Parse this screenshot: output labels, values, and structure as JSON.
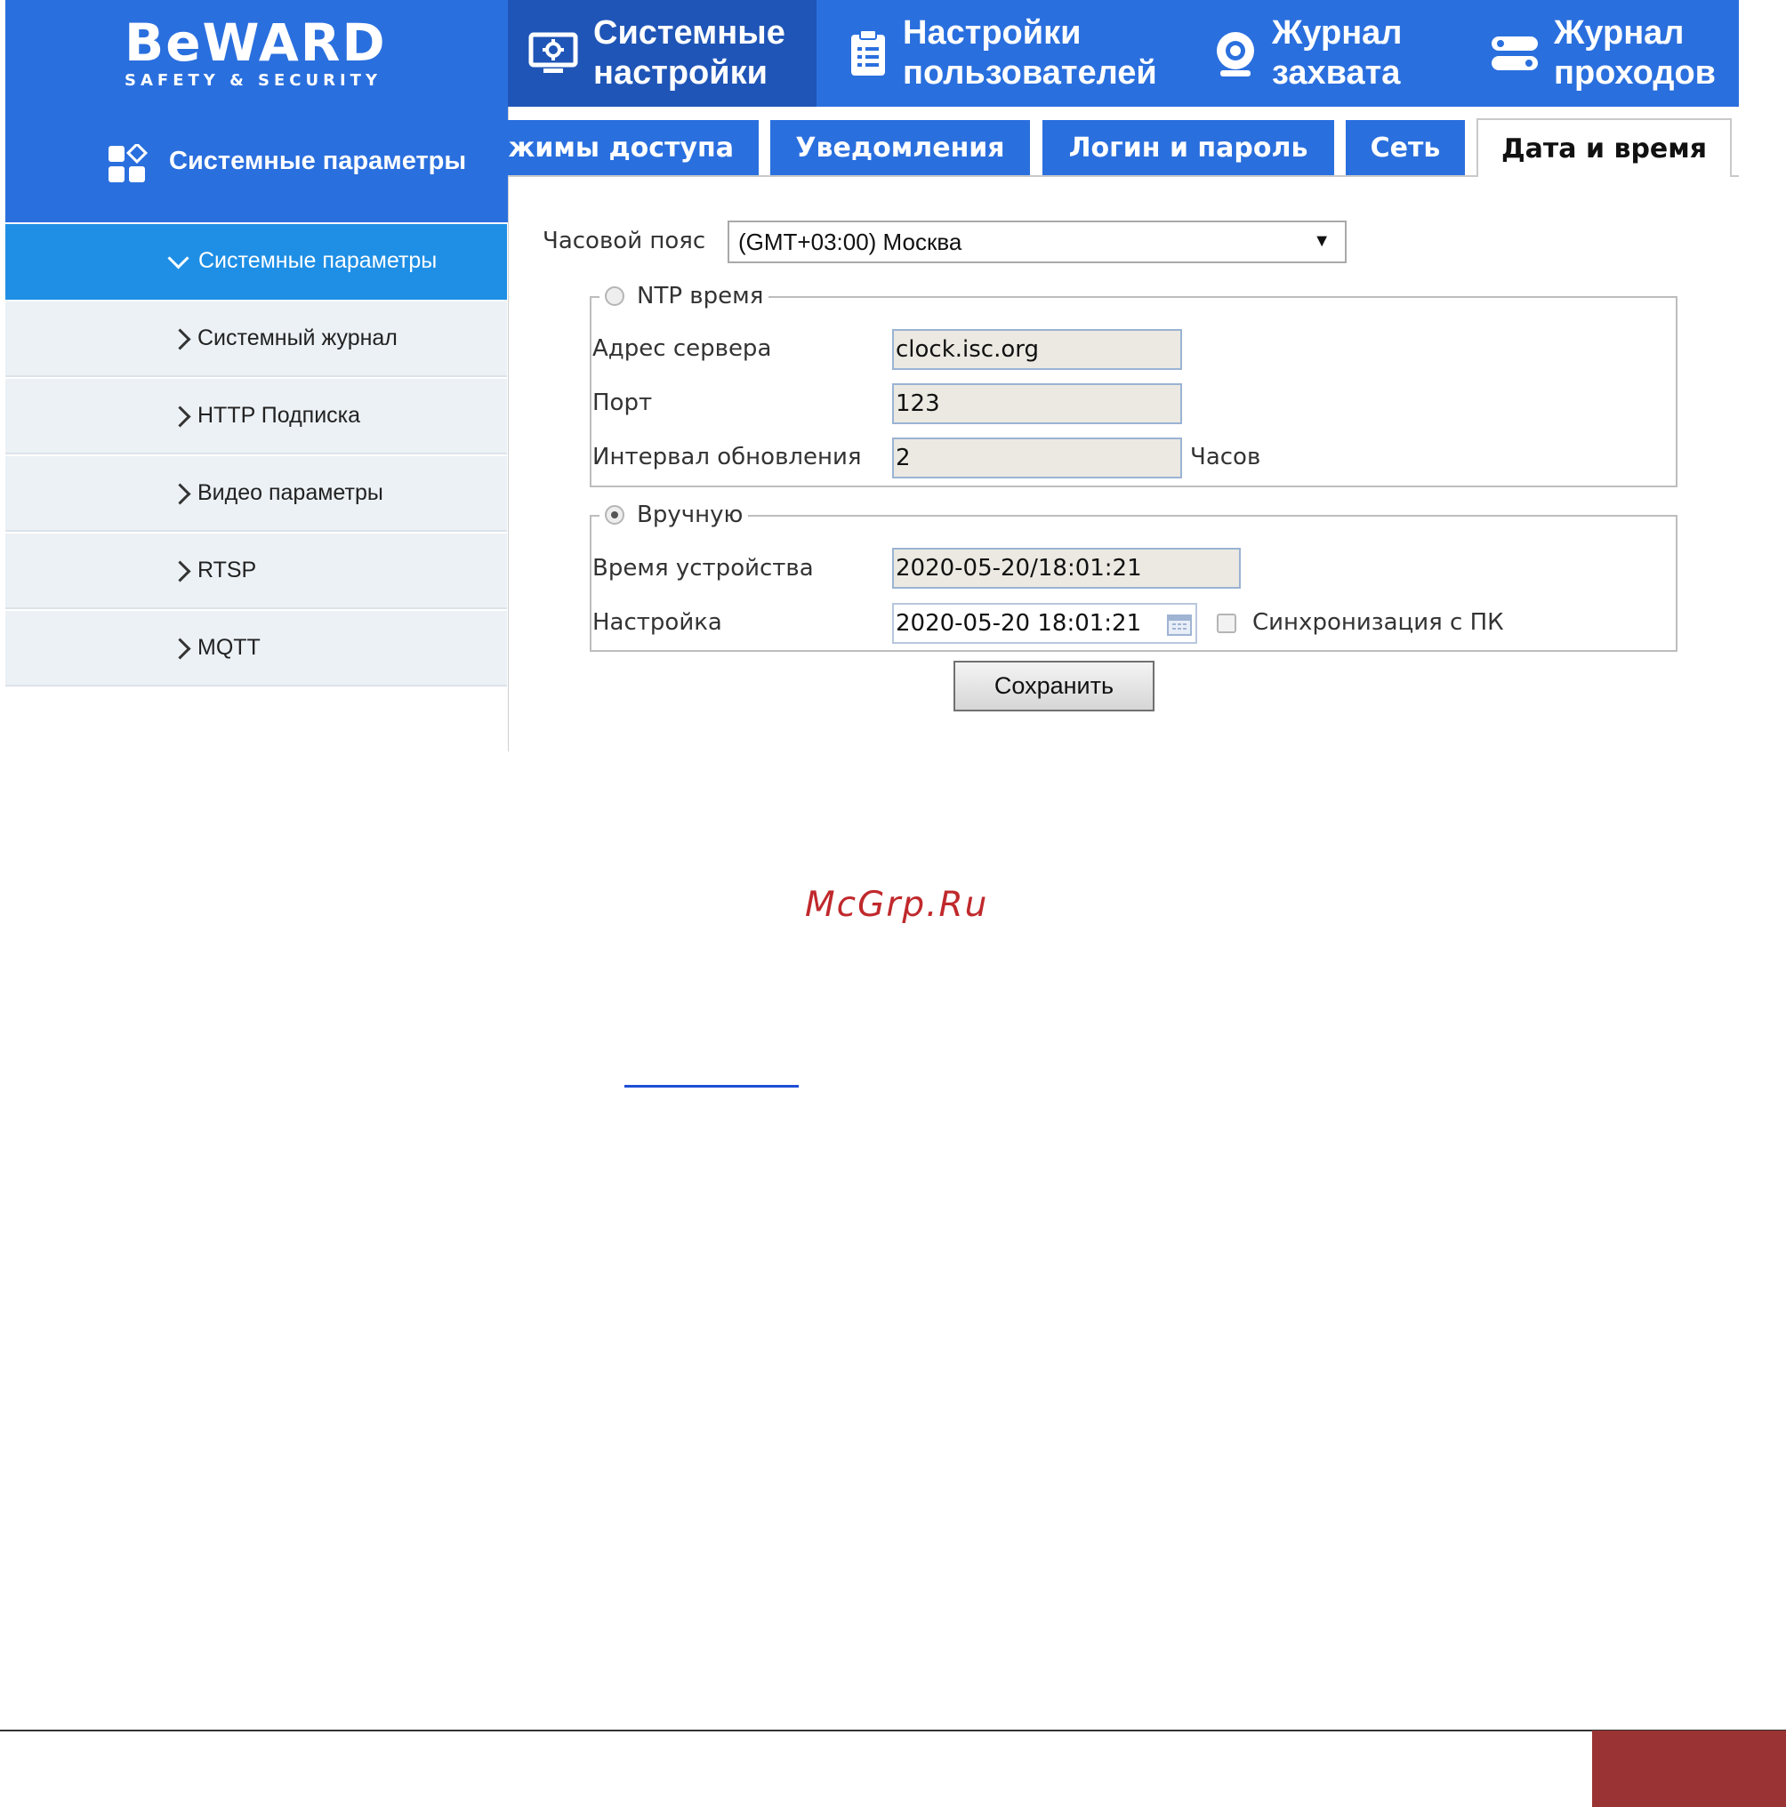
{
  "brand": {
    "logo": "BeWARD",
    "tagline": "SAFETY & SECURITY"
  },
  "topnav": [
    {
      "label": "Системные\nнастройки",
      "icon": "monitor-gear-icon",
      "active": true
    },
    {
      "label": "Настройки\nпользователей",
      "icon": "clipboard-icon",
      "active": false
    },
    {
      "label": "Журнал\nзахвата",
      "icon": "camera-icon",
      "active": false
    },
    {
      "label": "Журнал\nпроходов",
      "icon": "toggle-icon",
      "active": false
    }
  ],
  "sidebar": {
    "header": "Системные параметры",
    "active_item": "Системные параметры",
    "items": [
      "Системный журнал",
      "HTTP Подписка",
      "Видео параметры",
      "RTSP",
      "MQTT"
    ]
  },
  "tabs": [
    {
      "label": "жимы доступа",
      "active": false
    },
    {
      "label": "Уведомления",
      "active": false
    },
    {
      "label": "Логин и пароль",
      "active": false
    },
    {
      "label": "Сеть",
      "active": false
    },
    {
      "label": "Дата и время",
      "active": true
    }
  ],
  "form": {
    "timezone_label": "Часовой пояс",
    "timezone_value": "(GMT+03:00) Москва",
    "ntp": {
      "legend": "NTP время",
      "selected": false,
      "server_label": "Адрес сервера",
      "server_value": "clock.isc.org",
      "port_label": "Порт",
      "port_value": "123",
      "interval_label": "Интервал обновления",
      "interval_value": "2",
      "interval_unit": "Часов"
    },
    "manual": {
      "legend": "Вручную",
      "selected": true,
      "device_time_label": "Время устройства",
      "device_time_value": "2020-05-20/18:01:21",
      "setting_label": "Настройка",
      "setting_value": "2020-05-20 18:01:21",
      "sync_label": "Синхронизация с ПК",
      "sync_checked": false
    },
    "save_label": "Сохранить"
  },
  "watermark": "McGrp.Ru",
  "colors": {
    "primary": "#2a6fde",
    "active_nav": "#1f55b7",
    "sidebar_active": "#1f8fe5",
    "watermark": "#c0292c",
    "footer_block": "#9a3434"
  }
}
